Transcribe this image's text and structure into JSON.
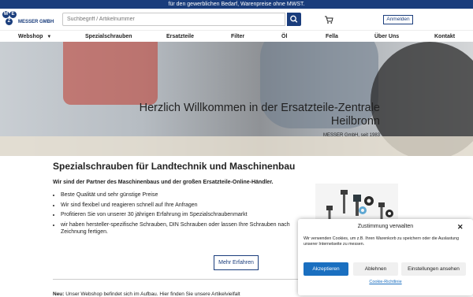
{
  "topbar": {
    "text": "für den gewerblichen Bedarf, Warenpreise ohne MWST."
  },
  "logo": {
    "letters": [
      "M",
      "E",
      "Z"
    ],
    "name": "MESSER GMBH"
  },
  "search": {
    "placeholder": "Suchbegriff / Artikelnummer"
  },
  "header": {
    "login_label": "Anmelden",
    "brand_color": "#1a3d7c"
  },
  "nav": {
    "items": [
      "Webshop",
      "Spezialschrauben",
      "Ersatzteile",
      "Filter",
      "Öl",
      "Fella",
      "Über Uns",
      "Kontakt"
    ]
  },
  "hero": {
    "line1": "Herzlich Willkommen in der Ersatzteile-Zentrale",
    "line2": "Heilbronn",
    "subtitle": "MESSER GmbH, seit 1983",
    "slide_count": 4,
    "active_slide": 1
  },
  "main": {
    "title": "Spezialschrauben für Landtechnik und Maschinenbau",
    "intro": "Wir sind der Partner des Maschinenbaus und der großen Ersatzteile-Online-Händler.",
    "bullets": [
      "Beste Qualität und sehr günstige Preise",
      "Wir sind flexibel und reagieren schnell auf Ihre Anfragen",
      "Profitieren Sie von unserer 30 jährigen Erfahrung im Spezialschraubenmarkt",
      "wir haben hersteller-spezifische Schrauben, DIN Schrauben oder lassen Ihre Schrauben nach Zeichnung fertigen."
    ],
    "more_label": "Mehr Erfahren",
    "note_bold": "Neu:",
    "note_text": " Unser Webshop befindet sich im Aufbau. Hier finden Sie unsere Artikelvielfalt"
  },
  "cookie": {
    "title": "Zustimmung verwalten",
    "text": "Wir verwenden Cookies, um z.B. Ihren Warenkorb zu speichern oder die Auslastung unserer Internetseite zu messen.",
    "accept_label": "Akzeptieren",
    "reject_label": "Ablehnen",
    "settings_label": "Einstellungen ansehen",
    "policy_link": "Cookie-Richtlinie"
  }
}
